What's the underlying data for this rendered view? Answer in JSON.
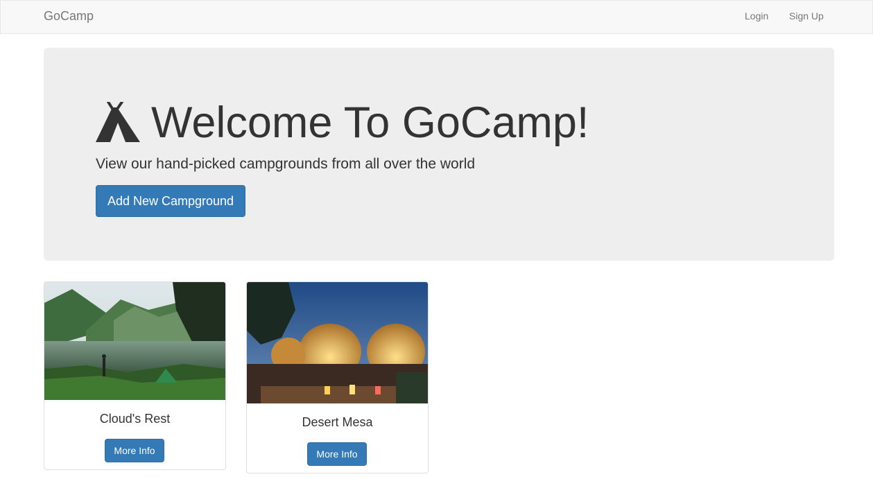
{
  "navbar": {
    "brand": "GoCamp",
    "links": [
      {
        "label": "Login"
      },
      {
        "label": "Sign Up"
      }
    ]
  },
  "hero": {
    "title": "Welcome To GoCamp!",
    "subtitle": "View our hand-picked campgrounds from all over the world",
    "button_label": "Add New Campground",
    "icon": "tent-icon"
  },
  "campgrounds": [
    {
      "name": "Cloud's Rest",
      "button_label": "More Info",
      "image": "lake-valley-camping-photo"
    },
    {
      "name": "Desert Mesa",
      "button_label": "More Info",
      "image": "glamping-domes-night-photo"
    }
  ],
  "colors": {
    "primary": "#337ab7",
    "navbar_bg": "#f8f8f8",
    "jumbotron_bg": "#eeeeee",
    "nav_text": "#777777"
  }
}
